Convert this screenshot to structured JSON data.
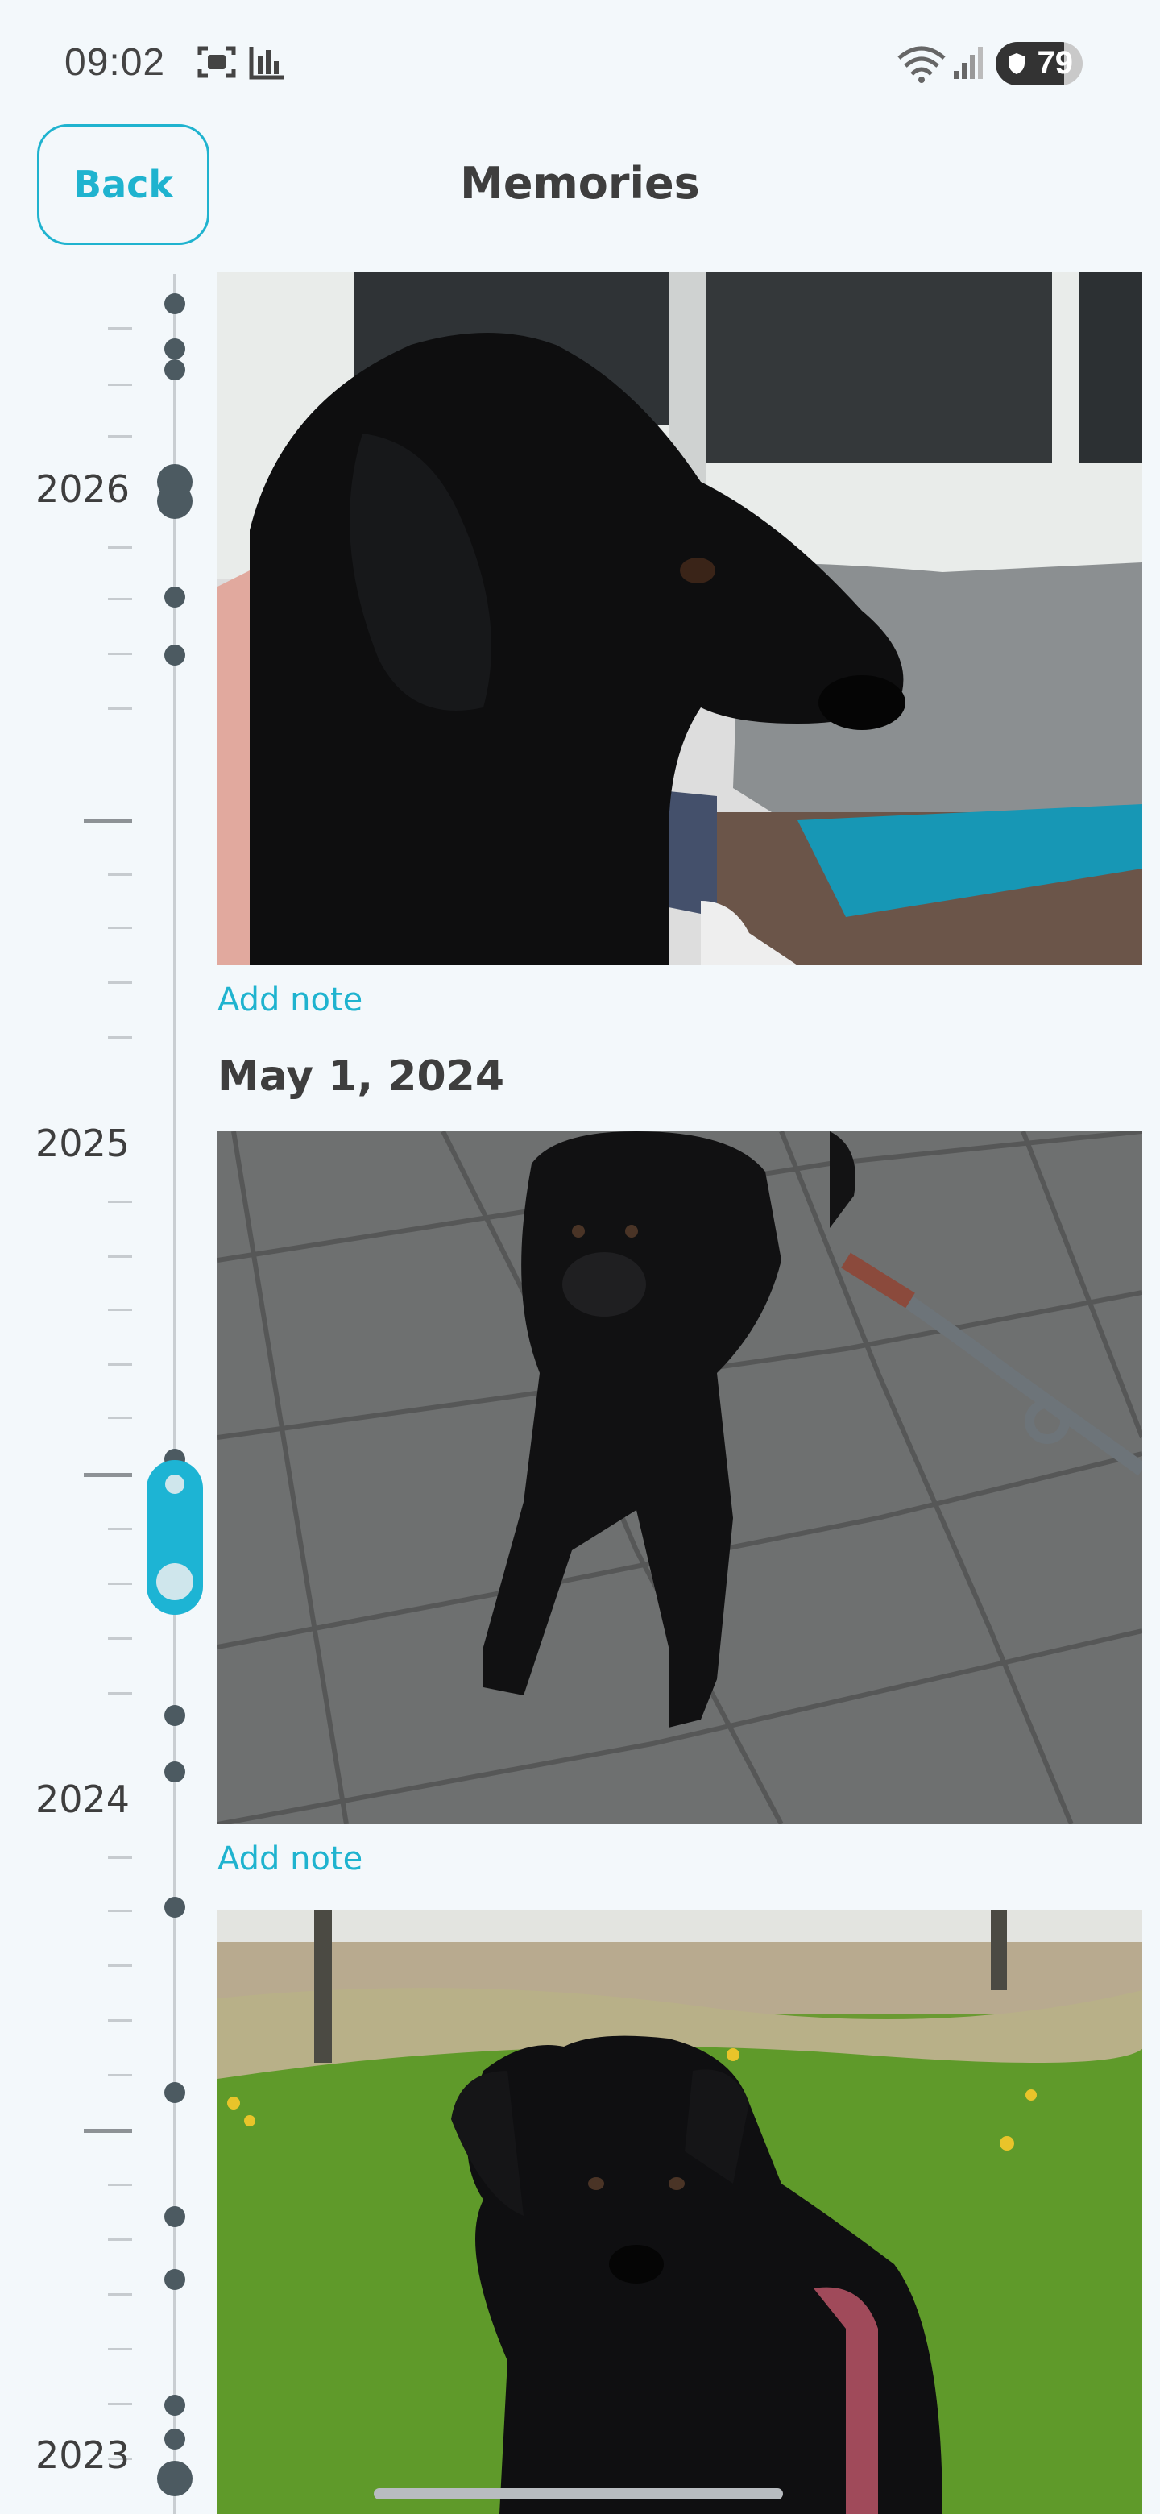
{
  "status_bar": {
    "time": "09:02",
    "battery_level": "79",
    "battery_percent": 79,
    "icons": [
      "screenshot-icon",
      "chart-icon",
      "wifi-icon",
      "signal-icon",
      "shield-icon"
    ]
  },
  "header": {
    "back_label": "Back",
    "title": "Memories"
  },
  "timeline": {
    "years": [
      "2026",
      "2025",
      "2024",
      "2023"
    ]
  },
  "feed": {
    "photo1_note": "Add note",
    "photo2_date": "May 1, 2024",
    "photo2_note": "Add note"
  },
  "colors": {
    "accent": "#1fb3cf",
    "background": "#f3f8fb",
    "text": "#3e3e3e",
    "timeline_dot": "#4c5a61"
  }
}
